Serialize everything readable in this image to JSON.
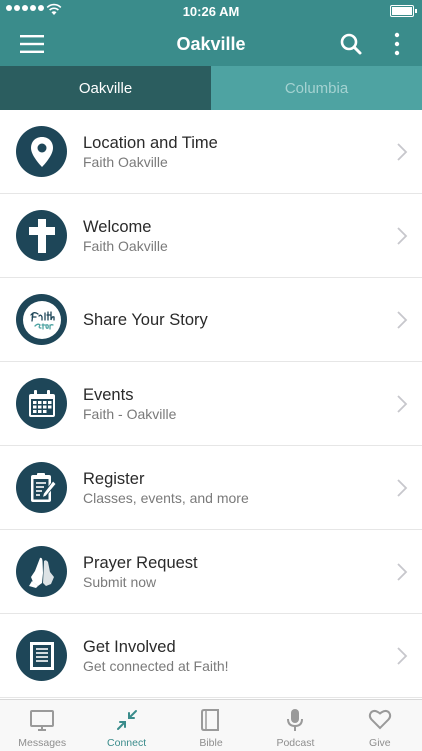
{
  "status_bar": {
    "time": "10:26 AM"
  },
  "nav": {
    "title": "Oakville"
  },
  "segments": [
    {
      "label": "Oakville"
    },
    {
      "label": "Columbia"
    }
  ],
  "rows": [
    {
      "title": "Location and Time",
      "subtitle": "Faith Oakville",
      "icon": "map-pin-icon"
    },
    {
      "title": "Welcome",
      "subtitle": "Faith Oakville",
      "icon": "cross-icon"
    },
    {
      "title": "Share Your Story",
      "subtitle": "",
      "icon": "faith-story-logo-icon"
    },
    {
      "title": "Events",
      "subtitle": "Faith - Oakville",
      "icon": "calendar-icon"
    },
    {
      "title": "Register",
      "subtitle": "Classes, events, and more",
      "icon": "clipboard-icon"
    },
    {
      "title": "Prayer Request",
      "subtitle": "Submit now",
      "icon": "praying-hands-icon"
    },
    {
      "title": "Get Involved",
      "subtitle": "Get connected at Faith!",
      "icon": "bulletin-icon"
    }
  ],
  "tabbar": [
    {
      "label": "Messages",
      "icon": "monitor-icon"
    },
    {
      "label": "Connect",
      "icon": "arrows-in-icon"
    },
    {
      "label": "Bible",
      "icon": "book-icon"
    },
    {
      "label": "Podcast",
      "icon": "microphone-icon"
    },
    {
      "label": "Give",
      "icon": "heart-icon"
    }
  ],
  "colors": {
    "primary": "#3a8c8b",
    "segment_active": "#2b5d5f",
    "segment_inactive": "#4ea3a2",
    "icon_circle": "#1e4658"
  }
}
